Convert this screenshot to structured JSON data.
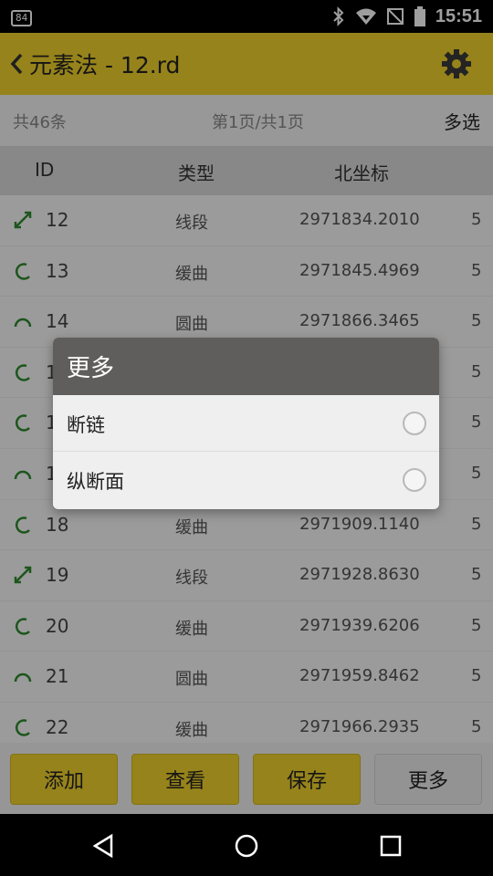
{
  "status_bar": {
    "badge": "84",
    "time": "15:51",
    "icons": [
      "bluetooth-icon",
      "wifi-icon",
      "no-sim-icon",
      "battery-icon"
    ]
  },
  "toolbar": {
    "title": "元素法 - 12.rd",
    "back_icon": "chevron-left-icon",
    "settings_icon": "gear-icon"
  },
  "info": {
    "count": "共46条",
    "page": "第1页/共1页",
    "multi_select": "多选"
  },
  "table": {
    "headers": [
      "ID",
      "类型",
      "北坐标"
    ],
    "rows": [
      {
        "icon": "line-icon",
        "id": "12",
        "type": "线段",
        "north": "2971834.2010",
        "next": "5"
      },
      {
        "icon": "spiral-icon",
        "id": "13",
        "type": "缓曲",
        "north": "2971845.4969",
        "next": "5"
      },
      {
        "icon": "arc-icon",
        "id": "14",
        "type": "圆曲",
        "north": "2971866.3465",
        "next": "5"
      },
      {
        "icon": "spiral-icon",
        "id": "1",
        "type": "",
        "north": "",
        "next": "5"
      },
      {
        "icon": "spiral-icon",
        "id": "1",
        "type": "",
        "north": "",
        "next": "5"
      },
      {
        "icon": "arc-icon",
        "id": "1",
        "type": "",
        "north": "",
        "next": "5"
      },
      {
        "icon": "spiral-icon",
        "id": "18",
        "type": "缓曲",
        "north": "2971909.1140",
        "next": "5"
      },
      {
        "icon": "line-icon",
        "id": "19",
        "type": "线段",
        "north": "2971928.8630",
        "next": "5"
      },
      {
        "icon": "spiral-icon",
        "id": "20",
        "type": "缓曲",
        "north": "2971939.6206",
        "next": "5"
      },
      {
        "icon": "arc-icon",
        "id": "21",
        "type": "圆曲",
        "north": "2971959.8462",
        "next": "5"
      },
      {
        "icon": "spiral-icon",
        "id": "22",
        "type": "缓曲",
        "north": "2971966.2935",
        "next": "5"
      }
    ]
  },
  "bottom_buttons": {
    "add": "添加",
    "view": "查看",
    "save": "保存",
    "more": "更多"
  },
  "dialog": {
    "title": "更多",
    "options": [
      "断链",
      "纵断面"
    ]
  },
  "colors": {
    "accent": "#f2d42c",
    "icon_green": "#2e8b2e",
    "dialog_header": "#5f5e5d"
  }
}
